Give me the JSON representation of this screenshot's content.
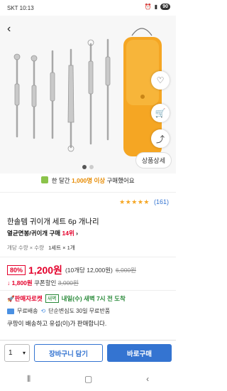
{
  "status_bar": {
    "carrier_time": "SKT 10:13",
    "battery": "90"
  },
  "hero": {
    "spec_button": "상품상세"
  },
  "buyers": {
    "prefix": "한 달간",
    "highlight": "1,000명 이상",
    "suffix": "구매했어요"
  },
  "rating": {
    "stars": "★★★★★",
    "count": "(161)"
  },
  "product": {
    "title": "한솔템 귀이개 세트 6p 개나리",
    "rank_label": "열균면봉/귀이개 구매",
    "rank_value": "14위",
    "rank_arrow": "›",
    "qty_label": "개당 수량 × 수량",
    "qty_value": "1세트 × 1개"
  },
  "price": {
    "discount": "80%",
    "sale": "1,200원",
    "unit": "(10개당 12,000원)",
    "original": "6,000원"
  },
  "coupon": {
    "arrow": "↓",
    "amount": "1,800원",
    "label": "쿠폰할인",
    "before": "3,000원"
  },
  "delivery": {
    "rocket": "🚀판매자로켓",
    "tag": "새벽",
    "date": "내일(수) 새벽 7시 전 도착",
    "free_shipping": "무료배송",
    "return_info": "단순변심도 30일 무료반품",
    "seller": "쿠팡이 배송하고 유섭(이)가 판매합니다."
  },
  "bottom": {
    "quantity": "1",
    "cart": "장바구니 담기",
    "buy": "바로구매"
  },
  "colors": {
    "accent": "#3474d1",
    "sale": "#e4002b",
    "case": "#f5a623"
  }
}
